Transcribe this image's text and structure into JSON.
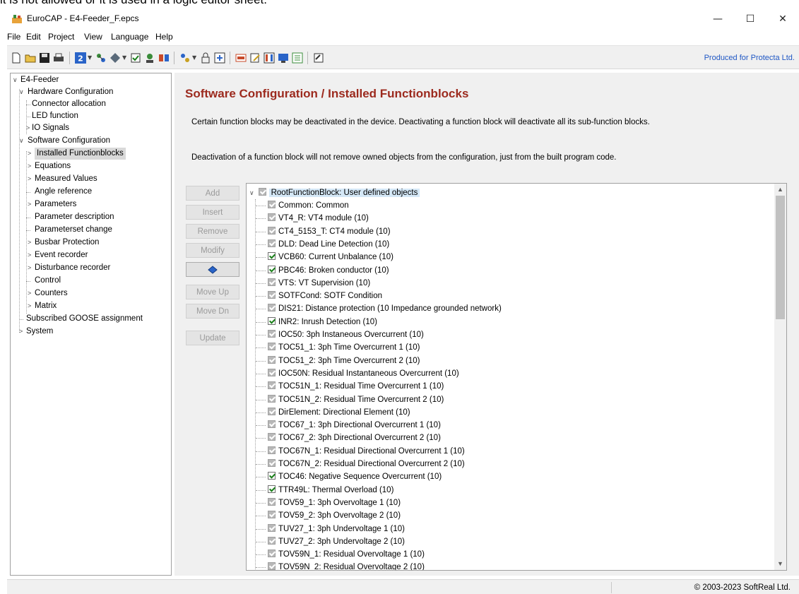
{
  "top_fragment": "it is not allowed or it is used in a logic editor sheet.",
  "window": {
    "title": "EuroCAP - E4-Feeder_F.epcs",
    "minimize": "—",
    "maximize": "☐",
    "close": "✕"
  },
  "menu": [
    "File",
    "Edit",
    "Project",
    "View",
    "Language",
    "Help"
  ],
  "toolbar": {
    "produced_for": "Produced for Protecta Ltd.",
    "number_badge": "2"
  },
  "tree": {
    "root": "E4-Feeder",
    "hardware": "Hardware Configuration",
    "hw_items": [
      "Connector allocation",
      "LED function",
      "IO Signals"
    ],
    "software": "Software Configuration",
    "sw_items": [
      "Installed Functionblocks",
      "Equations",
      "Measured Values",
      "Angle reference",
      "Parameters",
      "Parameter description",
      "Parameterset change",
      "Busbar Protection",
      "Event recorder",
      "Disturbance recorder",
      "Control",
      "Counters",
      "Matrix"
    ],
    "goose": "Subscribed GOOSE assignment",
    "system": "System"
  },
  "main": {
    "heading": "Software Configuration / Installed Functionblocks",
    "desc1": "Certain function blocks may be deactivated in the device. Deactivating a function block will deactivate all its sub-function blocks.",
    "desc2": "Deactivation of a function block will not remove owned objects from the configuration, just from the built program code.",
    "buttons": {
      "add": "Add",
      "insert": "Insert",
      "remove": "Remove",
      "modify": "Modify",
      "move_up": "Move Up",
      "move_dn": "Move Dn",
      "update": "Update"
    },
    "root_block": "RootFunctionBlock: User defined objects",
    "blocks": [
      {
        "label": "Common: Common",
        "editable": false
      },
      {
        "label": "VT4_R: VT4 module (10)",
        "editable": false
      },
      {
        "label": "CT4_5153_T: CT4 module (10)",
        "editable": false
      },
      {
        "label": "DLD: Dead Line Detection (10)",
        "editable": false
      },
      {
        "label": "VCB60: Current Unbalance (10)",
        "editable": true
      },
      {
        "label": "PBC46: Broken conductor (10)",
        "editable": true
      },
      {
        "label": "VTS: VT Supervision (10)",
        "editable": false
      },
      {
        "label": "SOTFCond: SOTF Condition",
        "editable": false
      },
      {
        "label": "DIS21: Distance protection (10 Impedance grounded network)",
        "editable": false
      },
      {
        "label": "INR2: Inrush Detection (10)",
        "editable": true
      },
      {
        "label": "IOC50: 3ph Instaneous Overcurrent (10)",
        "editable": false
      },
      {
        "label": "TOC51_1: 3ph Time Overcurrent 1 (10)",
        "editable": false
      },
      {
        "label": "TOC51_2: 3ph Time Overcurrent 2 (10)",
        "editable": false
      },
      {
        "label": "IOC50N: Residual Instantaneous Overcurrent (10)",
        "editable": false
      },
      {
        "label": "TOC51N_1: Residual Time Overcurrent 1 (10)",
        "editable": false
      },
      {
        "label": "TOC51N_2: Residual Time Overcurrent 2 (10)",
        "editable": false
      },
      {
        "label": "DirElement: Directional Element (10)",
        "editable": false
      },
      {
        "label": "TOC67_1: 3ph Directional Overcurrent 1 (10)",
        "editable": false
      },
      {
        "label": "TOC67_2: 3ph Directional Overcurrent 2 (10)",
        "editable": false
      },
      {
        "label": "TOC67N_1: Residual Directional Overcurrent 1 (10)",
        "editable": false
      },
      {
        "label": "TOC67N_2: Residual Directional Overcurrent 2 (10)",
        "editable": false
      },
      {
        "label": "TOC46: Negative Sequence Overcurrent (10)",
        "editable": true
      },
      {
        "label": "TTR49L: Thermal Overload (10)",
        "editable": true
      },
      {
        "label": "TOV59_1: 3ph Overvoltage 1 (10)",
        "editable": false
      },
      {
        "label": "TOV59_2: 3ph Overvoltage 2 (10)",
        "editable": false
      },
      {
        "label": "TUV27_1: 3ph Undervoltage 1 (10)",
        "editable": false
      },
      {
        "label": "TUV27_2: 3ph Undervoltage 2 (10)",
        "editable": false
      },
      {
        "label": "TOV59N_1: Residual Overvoltage 1 (10)",
        "editable": false
      },
      {
        "label": "TOV59N_2: Residual Overvoltage 2 (10)",
        "editable": false
      }
    ]
  },
  "status": {
    "copyright": "© 2003-2023 SoftReal Ltd."
  },
  "colors": {
    "heading": "#9c2a1e",
    "link": "#1f57c4",
    "selection": "#d5e8f7",
    "check": "#1a7f1a"
  }
}
